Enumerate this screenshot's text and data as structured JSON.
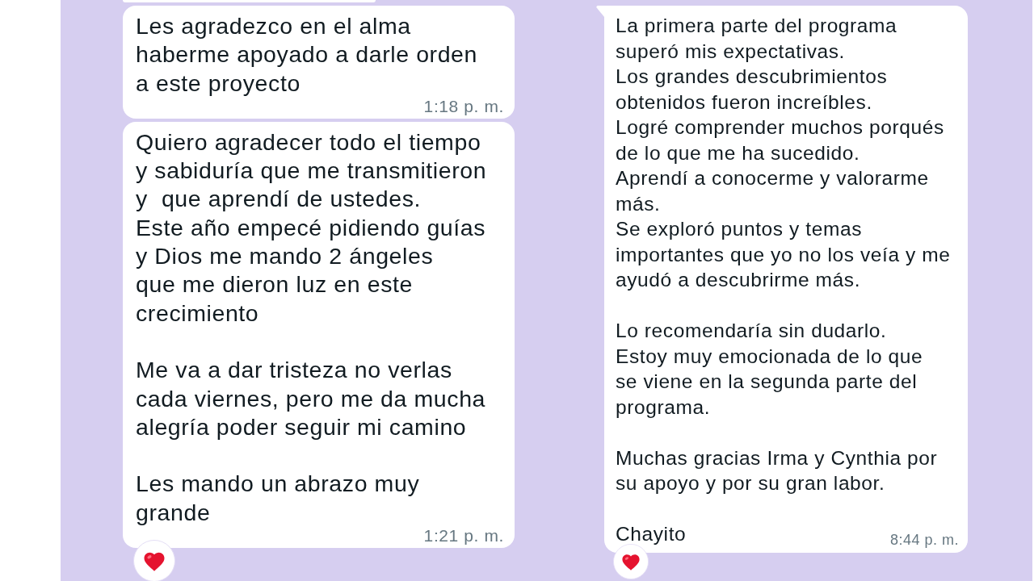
{
  "chats": [
    {
      "messages": [
        {
          "kind": "cut_off"
        },
        {
          "kind": "text",
          "tail": false,
          "reacted": false,
          "paragraphs": [
            "Les agradezco en el alma\nhaberme apoyado a darle orden\na este proyecto"
          ],
          "time": "1:18 p. m."
        },
        {
          "kind": "text",
          "tail": false,
          "reacted": true,
          "paragraphs": [
            "Quiero agradecer todo el tiempo\ny sabiduría que me transmitieron\ny  que aprendí de ustedes.\nEste año empecé pidiendo guías\ny Dios me mando 2 ángeles\nque me dieron luz en este\ncrecimiento",
            "Me va a dar tristeza no verlas\ncada viernes, pero me da mucha\nalegría poder seguir mi camino",
            "Les mando un abrazo muy\ngrande"
          ],
          "time": "1:21 p. m."
        }
      ]
    },
    {
      "messages": [
        {
          "kind": "text",
          "tail": true,
          "reacted": true,
          "paragraphs": [
            "La primera parte del programa\nsuperó mis expectativas.\nLos grandes descubrimientos\nobtenidos fueron increíbles.\nLogré comprender muchos porqués\nde lo que me ha sucedido.\nAprendí a conocerme y valorarme\nmás.\nSe exploró puntos y temas\nimportantes que yo no los veía y me\nayudó a descubrirme más.",
            "Lo recomendaría sin dudarlo.\nEstoy muy emocionada de lo que\nse viene en la segunda parte del\nprograma.",
            "Muchas gracias Irma y Cynthia por\nsu apoyo y por su gran labor.",
            "Chayito"
          ],
          "time": "8:44 p. m."
        }
      ]
    }
  ]
}
